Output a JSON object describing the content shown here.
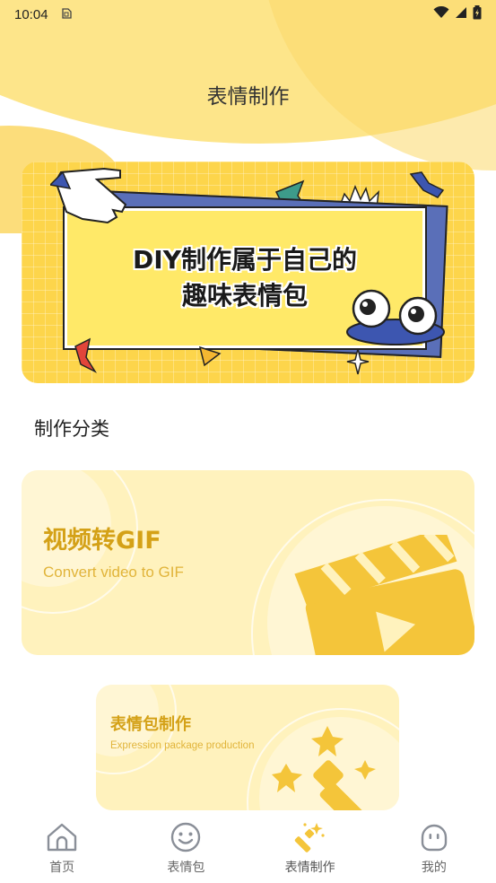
{
  "status_bar": {
    "time": "10:04"
  },
  "header": {
    "title": "表情制作"
  },
  "banner": {
    "line1": "DIY制作属于自己的",
    "line2": "趣味表情包"
  },
  "section": {
    "label": "制作分类"
  },
  "categories": [
    {
      "title": "视频转GIF",
      "subtitle": "Convert video to GIF"
    },
    {
      "title": "表情包制作",
      "subtitle": "Expression package production"
    }
  ],
  "tabs": [
    {
      "label": "首页",
      "icon": "home-icon"
    },
    {
      "label": "表情包",
      "icon": "smiley-icon"
    },
    {
      "label": "表情制作",
      "icon": "magic-wand-icon",
      "active": true
    },
    {
      "label": "我的",
      "icon": "ghost-face-icon"
    }
  ],
  "colors": {
    "accent": "#fdd54b",
    "card_bg": "#fff2bd",
    "card_text": "#d4a117",
    "active_icon": "#f4c53a"
  }
}
